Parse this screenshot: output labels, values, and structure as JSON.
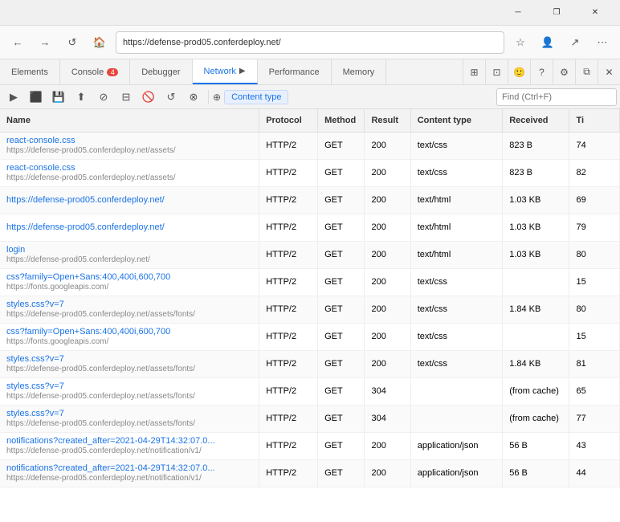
{
  "titleBar": {
    "minimizeLabel": "─",
    "maximizeLabel": "❐",
    "closeLabel": "✕"
  },
  "browserToolbar": {
    "icons": [
      "←",
      "→",
      "↺",
      "🏠"
    ]
  },
  "devtoolsTabs": [
    {
      "label": "Elements",
      "active": false,
      "badge": null
    },
    {
      "label": "Console",
      "active": false,
      "badge": "4"
    },
    {
      "label": "Debugger",
      "active": false,
      "badge": null
    },
    {
      "label": "Network",
      "active": true,
      "badge": null,
      "icon": "▶"
    },
    {
      "label": "Performance",
      "active": false,
      "badge": null
    },
    {
      "label": "Memory",
      "active": false,
      "badge": null
    }
  ],
  "networkToolbar": {
    "findPlaceholder": "Find (Ctrl+F)",
    "contentTypeLabel": "Content type",
    "filterIcon": "⊕"
  },
  "table": {
    "headers": [
      "Name",
      "Protocol",
      "Method",
      "Result",
      "Content type",
      "Received",
      "Ti"
    ],
    "rows": [
      {
        "name": "react-console.css",
        "url": "https://defense-prod05.conferdeploy.net/assets/",
        "protocol": "HTTP/2",
        "method": "GET",
        "result": "200",
        "contentType": "text/css",
        "received": "823 B",
        "time": "74"
      },
      {
        "name": "react-console.css",
        "url": "https://defense-prod05.conferdeploy.net/assets/",
        "protocol": "HTTP/2",
        "method": "GET",
        "result": "200",
        "contentType": "text/css",
        "received": "823 B",
        "time": "82"
      },
      {
        "name": "https://defense-prod05.conferdeploy.net/",
        "url": "",
        "protocol": "HTTP/2",
        "method": "GET",
        "result": "200",
        "contentType": "text/html",
        "received": "1.03 KB",
        "time": "69"
      },
      {
        "name": "https://defense-prod05.conferdeploy.net/",
        "url": "",
        "protocol": "HTTP/2",
        "method": "GET",
        "result": "200",
        "contentType": "text/html",
        "received": "1.03 KB",
        "time": "79"
      },
      {
        "name": "login",
        "url": "https://defense-prod05.conferdeploy.net/",
        "protocol": "HTTP/2",
        "method": "GET",
        "result": "200",
        "contentType": "text/html",
        "received": "1.03 KB",
        "time": "80"
      },
      {
        "name": "css?family=Open+Sans:400,400i,600,700",
        "url": "https://fonts.googleapis.com/",
        "protocol": "HTTP/2",
        "method": "GET",
        "result": "200",
        "contentType": "text/css",
        "received": "",
        "time": "15"
      },
      {
        "name": "styles.css?v=7",
        "url": "https://defense-prod05.conferdeploy.net/assets/fonts/",
        "protocol": "HTTP/2",
        "method": "GET",
        "result": "200",
        "contentType": "text/css",
        "received": "1.84 KB",
        "time": "80"
      },
      {
        "name": "css?family=Open+Sans:400,400i,600,700",
        "url": "https://fonts.googleapis.com/",
        "protocol": "HTTP/2",
        "method": "GET",
        "result": "200",
        "contentType": "text/css",
        "received": "",
        "time": "15"
      },
      {
        "name": "styles.css?v=7",
        "url": "https://defense-prod05.conferdeploy.net/assets/fonts/",
        "protocol": "HTTP/2",
        "method": "GET",
        "result": "200",
        "contentType": "text/css",
        "received": "1.84 KB",
        "time": "81"
      },
      {
        "name": "styles.css?v=7",
        "url": "https://defense-prod05.conferdeploy.net/assets/fonts/",
        "protocol": "HTTP/2",
        "method": "GET",
        "result": "304",
        "contentType": "",
        "received": "(from cache)",
        "time": "65"
      },
      {
        "name": "styles.css?v=7",
        "url": "https://defense-prod05.conferdeploy.net/assets/fonts/",
        "protocol": "HTTP/2",
        "method": "GET",
        "result": "304",
        "contentType": "",
        "received": "(from cache)",
        "time": "77"
      },
      {
        "name": "notifications?created_after=2021-04-29T14:32:07.0...",
        "url": "https://defense-prod05.conferdeploy.net/notification/v1/",
        "protocol": "HTTP/2",
        "method": "GET",
        "result": "200",
        "contentType": "application/json",
        "received": "56 B",
        "time": "43"
      },
      {
        "name": "notifications?created_after=2021-04-29T14:32:07.0...",
        "url": "https://defense-prod05.conferdeploy.net/notification/v1/",
        "protocol": "HTTP/2",
        "method": "GET",
        "result": "200",
        "contentType": "application/json",
        "received": "56 B",
        "time": "44"
      }
    ]
  }
}
